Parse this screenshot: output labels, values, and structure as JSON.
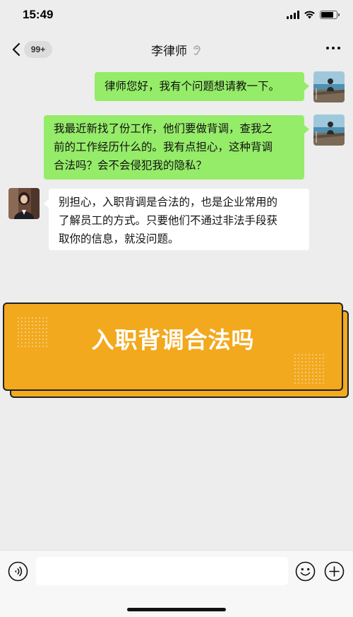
{
  "status_bar": {
    "time": "15:49",
    "signal_icon": "cellular-signal-icon",
    "wifi_icon": "wifi-icon",
    "battery_icon": "battery-icon",
    "battery_level": 0.8
  },
  "nav": {
    "back_icon": "chevron-left-icon",
    "unread_badge": "99+",
    "title": "李律师",
    "title_icon": "ear-icon",
    "more_icon": "more-dots-icon"
  },
  "messages": [
    {
      "sender": "me",
      "avatar": "user-avatar-seaside",
      "text": "律师您好，我有个问题想请教一下。"
    },
    {
      "sender": "me",
      "avatar": "user-avatar-seaside",
      "lines": [
        "我最近新找了份工作，他们要做背调，查我之",
        "前的工作经历什么的。我有点担心，这种背调",
        "合法吗？会不会侵犯我的隐私？"
      ]
    },
    {
      "sender": "other",
      "avatar": "lawyer-avatar",
      "lines": [
        "别担心，入职背调是合法的，也是企业常用的",
        "了解员工的方式。只要他们不通过非法手段获",
        "取你的信息，就没问题。"
      ]
    }
  ],
  "banner": {
    "title": "入职背调合法吗"
  },
  "input_bar": {
    "voice_icon": "voice-icon",
    "input_value": "",
    "emoji_icon": "emoji-icon",
    "plus_icon": "plus-circle-icon"
  },
  "colors": {
    "background": "#ededed",
    "my_bubble": "#95ec69",
    "other_bubble": "#ffffff",
    "banner": "#f2a91e",
    "banner_text": "#ffffff"
  }
}
